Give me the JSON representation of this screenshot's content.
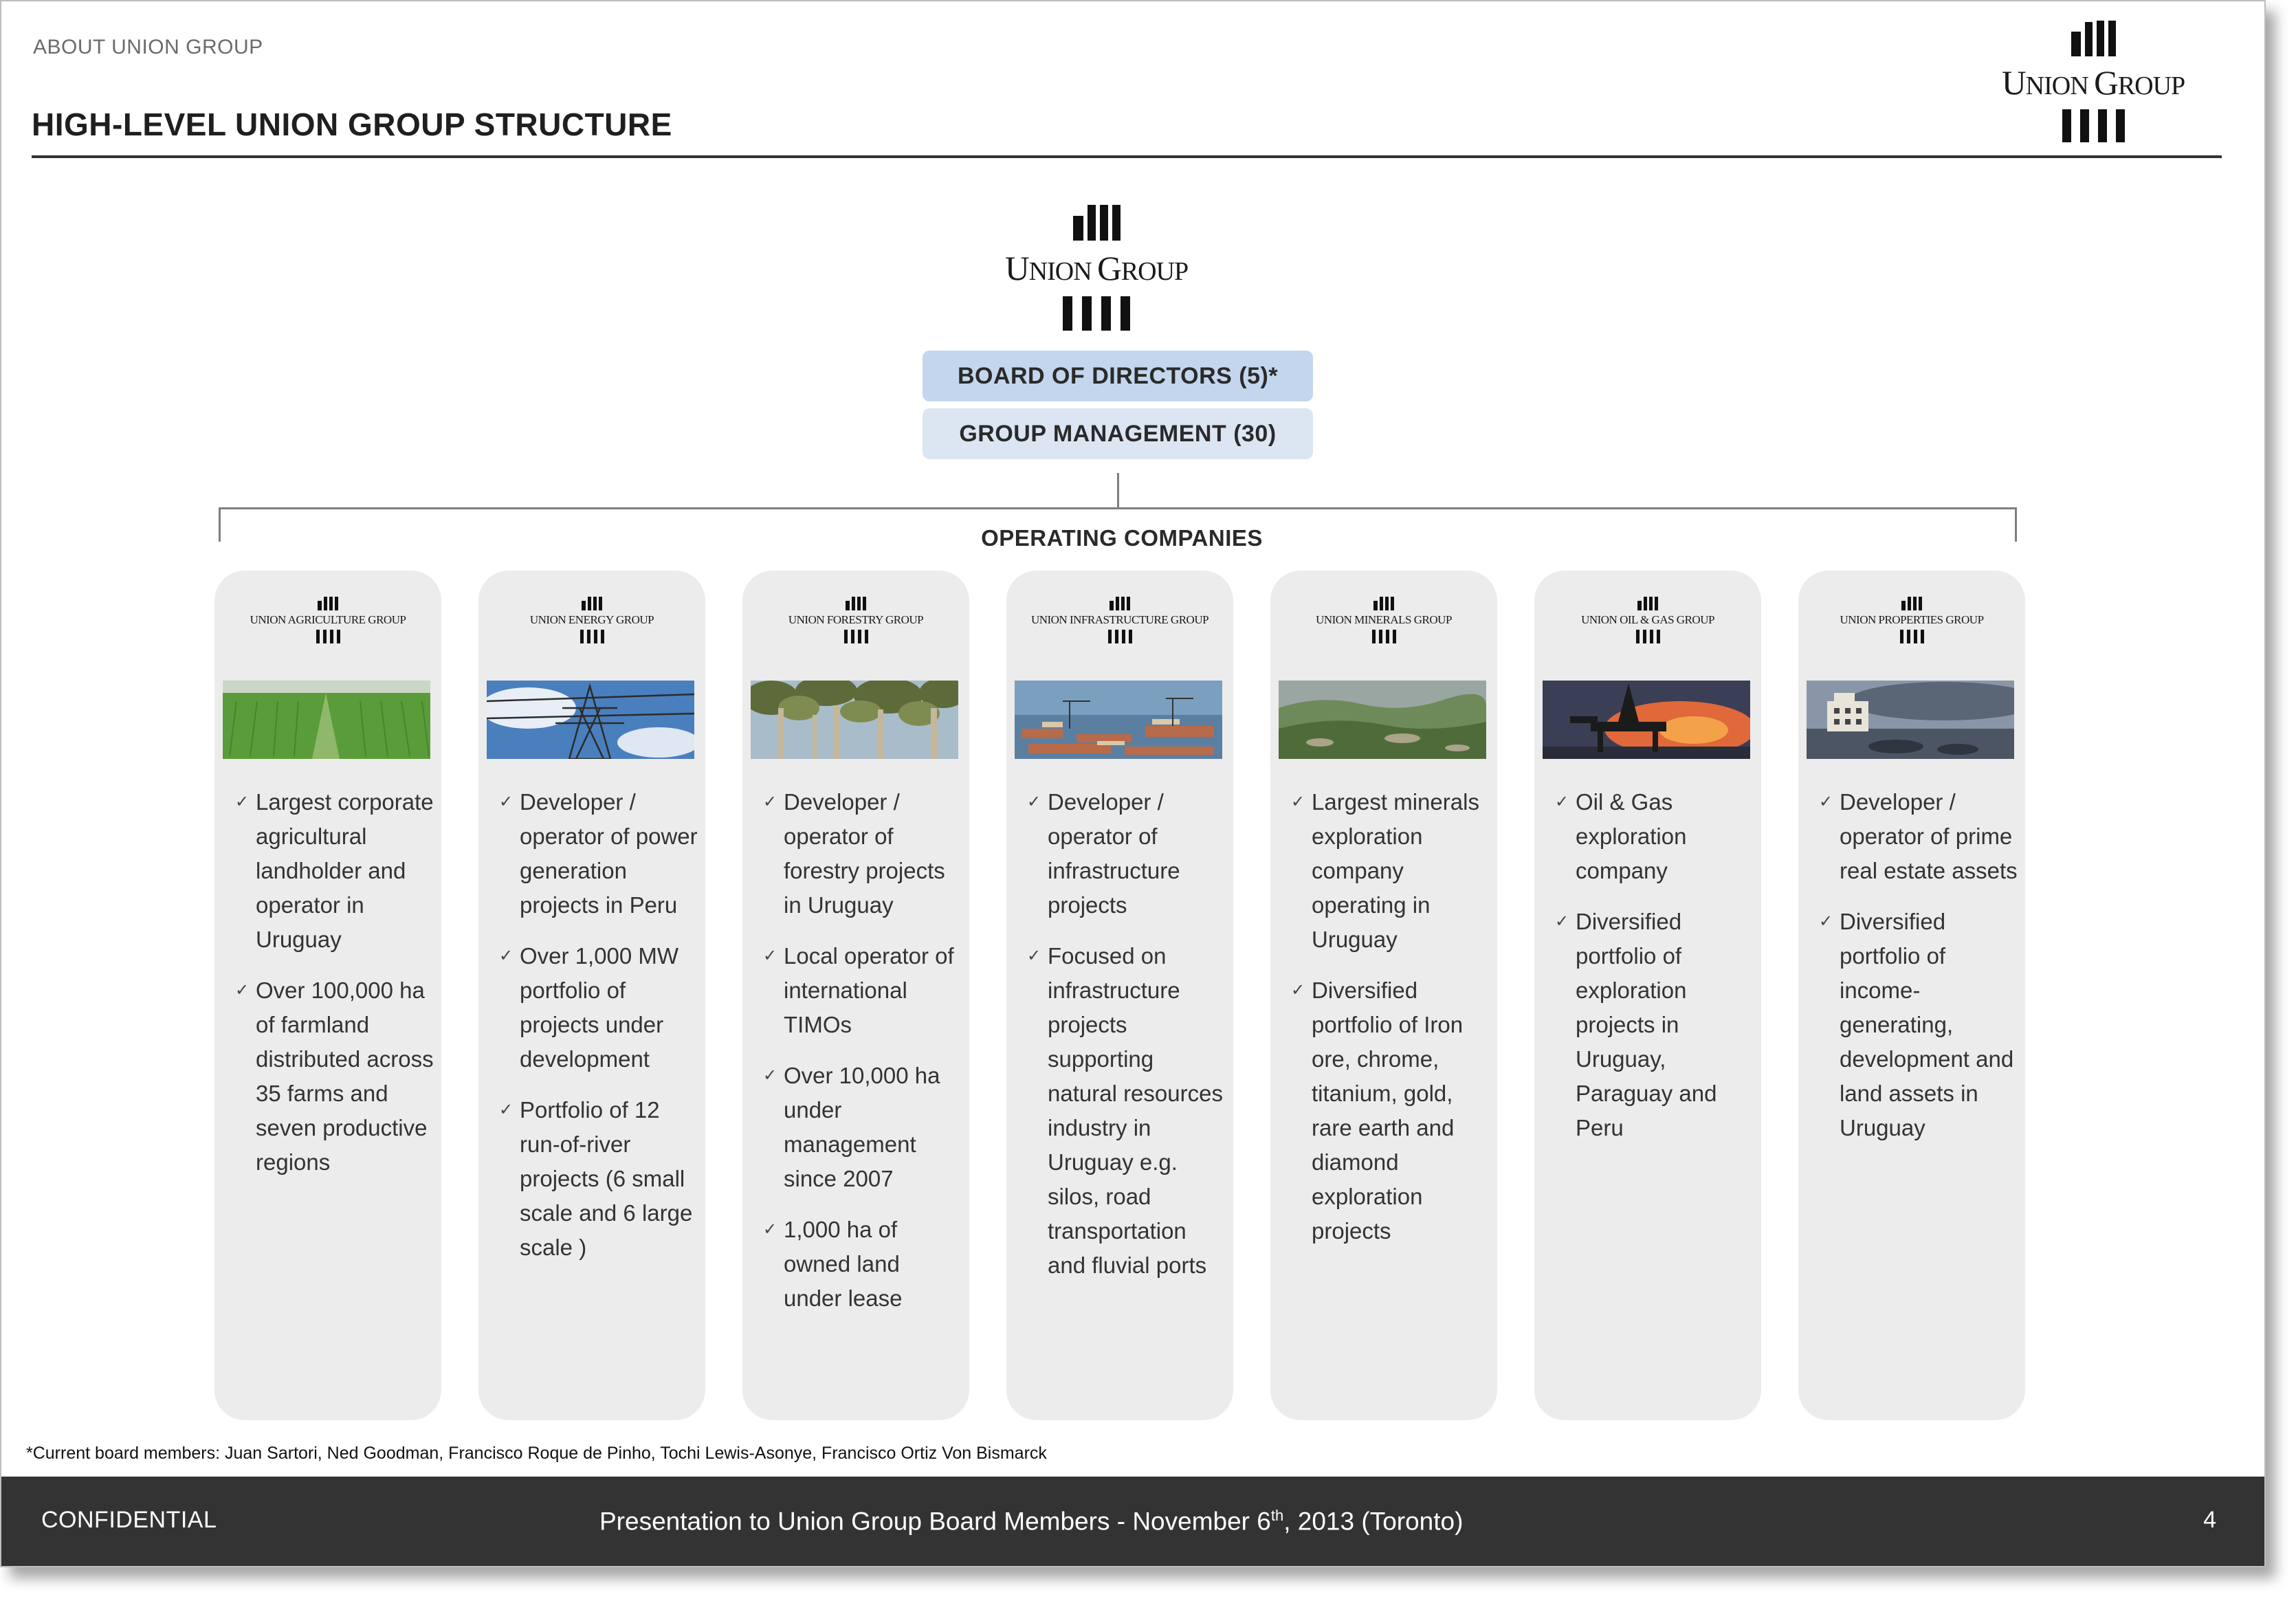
{
  "header": {
    "section_label": "ABOUT UNION GROUP",
    "title": "HIGH-LEVEL UNION GROUP STRUCTURE",
    "logo_text": "Union Group"
  },
  "org": {
    "logo_text": "Union Group",
    "board": "BOARD OF DIRECTORS (5)*",
    "management": "GROUP MANAGEMENT (30)",
    "operating_heading": "OPERATING COMPANIES"
  },
  "companies": [
    {
      "name": "Union Agriculture Group",
      "photo": "rice-field",
      "bullets": [
        "Largest corporate agricultural landholder and operator in Uruguay",
        "Over 100,000 ha of farmland distributed across 35 farms and seven productive regions"
      ]
    },
    {
      "name": "Union Energy Group",
      "photo": "power-tower",
      "bullets": [
        "Developer / operator of power generation projects in Peru",
        "Over 1,000 MW portfolio of projects under development",
        "Portfolio of 12 run-of-river projects  (6 small scale and 6 large scale )"
      ]
    },
    {
      "name": "Union Forestry Group",
      "photo": "forest",
      "bullets": [
        "Developer / operator of forestry projects in Uruguay",
        "Local operator of international TIMOs",
        "Over 10,000 ha under management since 2007",
        "1,000 ha of owned land under lease"
      ]
    },
    {
      "name": "Union Infrastructure Group",
      "photo": "port",
      "bullets": [
        "Developer / operator of infrastructure projects",
        "Focused on infrastructure projects supporting natural resources industry in Uruguay e.g. silos, road transportation and fluvial ports"
      ]
    },
    {
      "name": "Union Minerals Group",
      "photo": "hills",
      "bullets": [
        "Largest minerals exploration company operating in Uruguay",
        "Diversified portfolio of Iron ore, chrome, titanium, gold, rare earth and diamond exploration projects"
      ]
    },
    {
      "name": "Union Oil & Gas Group",
      "photo": "oil-rig",
      "bullets": [
        "Oil & Gas exploration company",
        "Diversified portfolio of exploration projects in Uruguay, Paraguay and Peru"
      ]
    },
    {
      "name": "Union Properties Group",
      "photo": "coastal-property",
      "bullets": [
        "Developer / operator of prime real estate assets",
        "Diversified portfolio of income-generating, development and land assets in Uruguay"
      ]
    }
  ],
  "footnote": "*Current board members: Juan Sartori, Ned Goodman, Francisco Roque de Pinho, Tochi Lewis-Asonye, Francisco Ortiz Von Bismarck",
  "footer": {
    "confidential": "CONFIDENTIAL",
    "presentation_prefix": "Presentation to Union Group Board Members - November 6",
    "presentation_sup": "th",
    "presentation_suffix": ", 2013 (Toronto)",
    "page_number": "4"
  }
}
